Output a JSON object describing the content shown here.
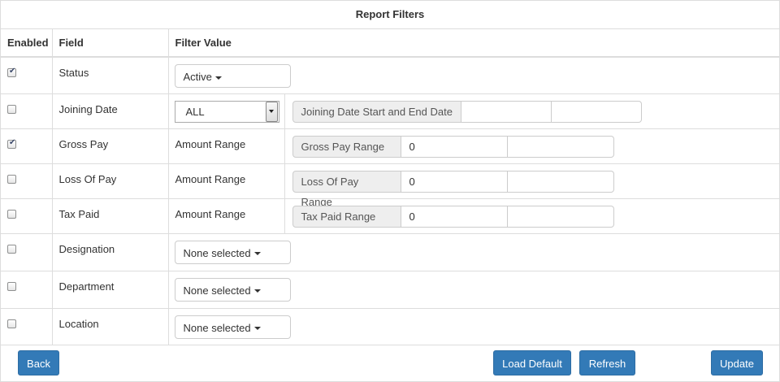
{
  "title": "Report Filters",
  "headers": {
    "enabled": "Enabled",
    "field": "Field",
    "value": "Filter Value"
  },
  "rows": [
    {
      "field": "Status",
      "checked": true,
      "dropdown": "Active"
    },
    {
      "field": "Joining Date",
      "checked": false,
      "select": "ALL",
      "addon": "Joining Date Start and End Date",
      "v1": "",
      "v2": ""
    },
    {
      "field": "Gross Pay",
      "checked": true,
      "text": "Amount Range",
      "addon": "Gross Pay Range",
      "v1": "0",
      "v2": ""
    },
    {
      "field": "Loss Of Pay",
      "checked": false,
      "text": "Amount Range",
      "addon": "Loss Of Pay Range",
      "v1": "0",
      "v2": ""
    },
    {
      "field": "Tax Paid",
      "checked": false,
      "text": "Amount Range",
      "addon": "Tax Paid Range",
      "v1": "0",
      "v2": ""
    },
    {
      "field": "Designation",
      "checked": false,
      "dropdown": "None selected"
    },
    {
      "field": "Department",
      "checked": false,
      "dropdown": "None selected"
    },
    {
      "field": "Location",
      "checked": false,
      "dropdown": "None selected"
    }
  ],
  "buttons": {
    "back": "Back",
    "load_default": "Load Default",
    "refresh": "Refresh",
    "update": "Update"
  },
  "colors": {
    "primary": "#337ab7",
    "addon_bg": "#eeeeee",
    "border": "#dddddd"
  }
}
